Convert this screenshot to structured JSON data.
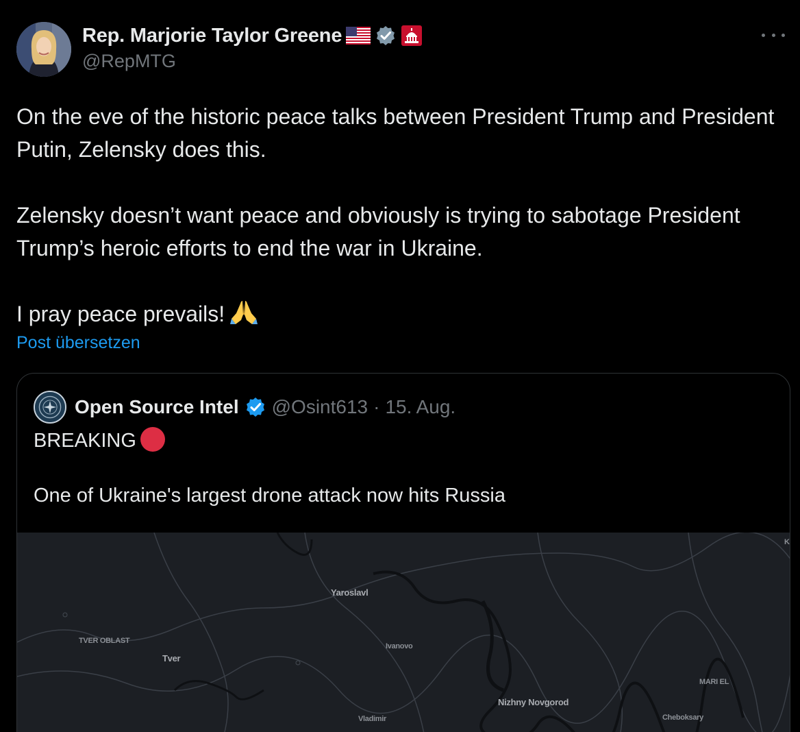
{
  "author": {
    "display_name": "Rep. Marjorie Taylor Greene",
    "handle": "@RepMTG",
    "badges": [
      "us-flag-icon",
      "verified-gray-badge-icon",
      "capitol-icon"
    ]
  },
  "tweet": {
    "paragraphs": [
      "On the eve of the historic peace talks between President Trump and President Putin, Zelensky does this.",
      "Zelensky doesn’t want peace and obviously is trying to sabotage President Trump’s heroic efforts to end the war in Ukraine.",
      "I pray peace prevails!"
    ],
    "emoji": "folded-hands-icon",
    "translate_label": "Post übersetzen"
  },
  "quoted": {
    "display_name": "Open Source Intel",
    "handle": "@Osint613",
    "separator": "·",
    "date": "15. Aug.",
    "line1": "BREAKING",
    "line2": "One of Ukraine's largest drone attack now hits Russia",
    "map_labels": {
      "tver_oblast": "TVER OBLAST",
      "tver": "Tver",
      "yaroslavl": "Yaroslavl",
      "ivanovo": "Ivanovo",
      "nizhny": "Nizhny Novgorod",
      "vladimir": "Vladimir",
      "mari_el": "MARI EL",
      "cheboksary": "Cheboksary",
      "corner": "K"
    }
  },
  "colors": {
    "background": "#000000",
    "text": "#e7e9ea",
    "muted": "#71767b",
    "link": "#1d9bf0",
    "border": "#2f3336",
    "alert_red": "#dd2e44"
  }
}
